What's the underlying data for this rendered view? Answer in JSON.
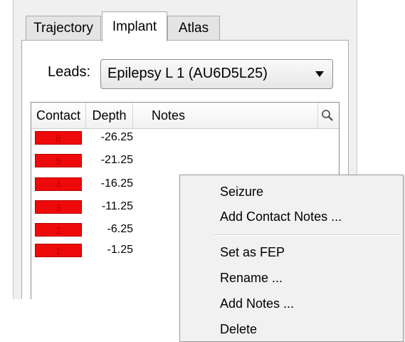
{
  "tabs": [
    {
      "label": "Trajectory"
    },
    {
      "label": "Implant"
    },
    {
      "label": "Atlas"
    }
  ],
  "leads": {
    "label": "Leads:",
    "selected": "Epilepsy L 1 (AU6D5L25)"
  },
  "table": {
    "columns": [
      "Contact",
      "Depth",
      "Notes"
    ],
    "rows": [
      {
        "contact": "6",
        "depth": "-26.25",
        "notes": ""
      },
      {
        "contact": "5",
        "depth": "-21.25",
        "notes": ""
      },
      {
        "contact": "4",
        "depth": "-16.25",
        "notes": ""
      },
      {
        "contact": "3",
        "depth": "-11.25",
        "notes": ""
      },
      {
        "contact": "2",
        "depth": "-6.25",
        "notes": ""
      },
      {
        "contact": "1",
        "depth": "-1.25",
        "notes": ""
      }
    ],
    "contact_color": "#ee0a0a"
  },
  "context_menu": {
    "items": [
      "Seizure",
      "Add Contact Notes ...",
      "Set as FEP",
      "Rename ...",
      "Add Notes ...",
      "Delete"
    ]
  }
}
